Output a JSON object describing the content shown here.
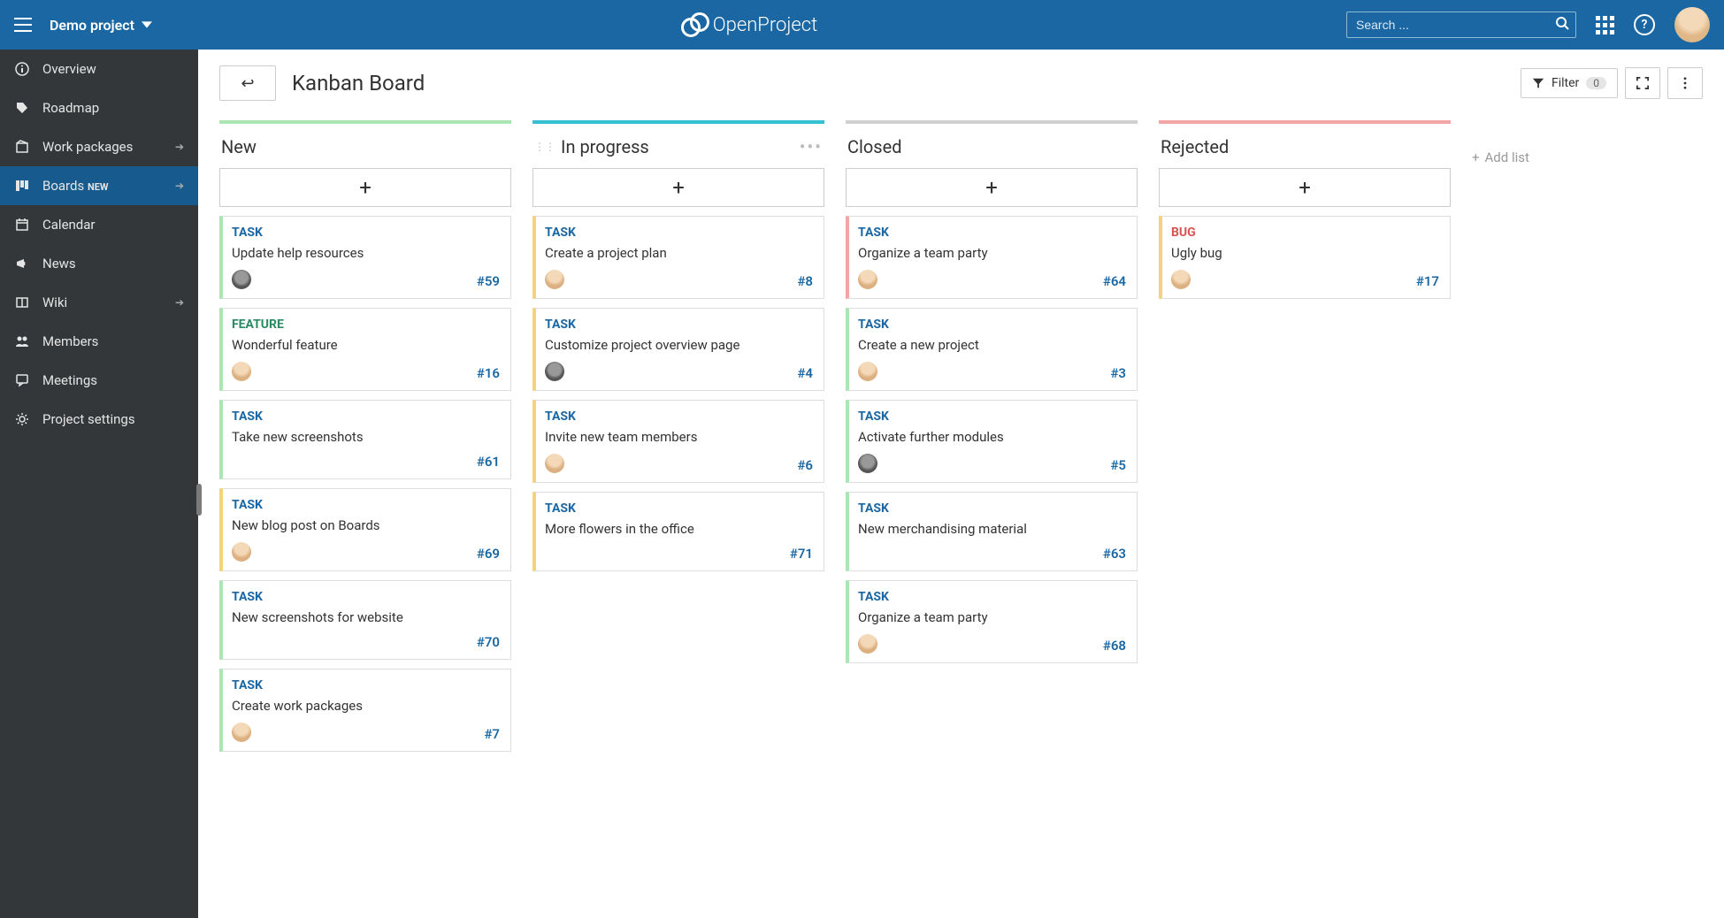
{
  "header": {
    "project_name": "Demo project",
    "app_name": "OpenProject",
    "search_placeholder": "Search ...",
    "help_char": "?"
  },
  "sidebar": {
    "items": [
      {
        "icon": "info-icon",
        "label": "Overview",
        "active": false,
        "arrow": false,
        "badge": ""
      },
      {
        "icon": "tag-icon",
        "label": "Roadmap",
        "active": false,
        "arrow": false,
        "badge": ""
      },
      {
        "icon": "package-icon",
        "label": "Work packages",
        "active": false,
        "arrow": true,
        "badge": ""
      },
      {
        "icon": "board-icon",
        "label": "Boards",
        "active": true,
        "arrow": true,
        "badge": "NEW"
      },
      {
        "icon": "calendar-icon",
        "label": "Calendar",
        "active": false,
        "arrow": false,
        "badge": ""
      },
      {
        "icon": "megaphone-icon",
        "label": "News",
        "active": false,
        "arrow": false,
        "badge": ""
      },
      {
        "icon": "book-icon",
        "label": "Wiki",
        "active": false,
        "arrow": true,
        "badge": ""
      },
      {
        "icon": "people-icon",
        "label": "Members",
        "active": false,
        "arrow": false,
        "badge": ""
      },
      {
        "icon": "chat-icon",
        "label": "Meetings",
        "active": false,
        "arrow": false,
        "badge": ""
      },
      {
        "icon": "gear-icon",
        "label": "Project settings",
        "active": false,
        "arrow": false,
        "badge": ""
      }
    ]
  },
  "board": {
    "title": "Kanban Board",
    "filter_label": "Filter",
    "filter_count": "0",
    "add_list_label": "Add list",
    "columns": [
      {
        "name": "New",
        "barColor": "#a9e6b4",
        "borderColor": "#a9e6b4",
        "showMore": false,
        "cards": [
          {
            "type": "TASK",
            "title": "Update help resources",
            "id": "#59",
            "avatar": "alt"
          },
          {
            "type": "FEATURE",
            "title": "Wonderful feature",
            "id": "#16",
            "avatar": "std"
          },
          {
            "type": "TASK",
            "title": "Take new screenshots",
            "id": "#61",
            "avatar": "none"
          },
          {
            "type": "TASK",
            "title": "New blog post on Boards",
            "id": "#69",
            "avatar": "std",
            "borderOverride": "#f4d37a"
          },
          {
            "type": "TASK",
            "title": "New screenshots for website",
            "id": "#70",
            "avatar": "none"
          },
          {
            "type": "TASK",
            "title": "Create work packages",
            "id": "#7",
            "avatar": "std"
          }
        ]
      },
      {
        "name": "In progress",
        "barColor": "#34c2d2",
        "borderColor": "#f4d37a",
        "showMore": true,
        "cards": [
          {
            "type": "TASK",
            "title": "Create a project plan",
            "id": "#8",
            "avatar": "std"
          },
          {
            "type": "TASK",
            "title": "Customize project overview page",
            "id": "#4",
            "avatar": "alt"
          },
          {
            "type": "TASK",
            "title": "Invite new team members",
            "id": "#6",
            "avatar": "std"
          },
          {
            "type": "TASK",
            "title": "More flowers in the office",
            "id": "#71",
            "avatar": "none"
          }
        ]
      },
      {
        "name": "Closed",
        "barColor": "#d0d0d0",
        "borderColor": "#a9e6b4",
        "showMore": false,
        "cards": [
          {
            "type": "TASK",
            "title": "Organize a team party",
            "id": "#64",
            "avatar": "std",
            "borderOverride": "#f3a6a6"
          },
          {
            "type": "TASK",
            "title": "Create a new project",
            "id": "#3",
            "avatar": "std"
          },
          {
            "type": "TASK",
            "title": "Activate further modules",
            "id": "#5",
            "avatar": "alt"
          },
          {
            "type": "TASK",
            "title": "New merchandising material",
            "id": "#63",
            "avatar": "none"
          },
          {
            "type": "TASK",
            "title": "Organize a team party",
            "id": "#68",
            "avatar": "std"
          }
        ]
      },
      {
        "name": "Rejected",
        "barColor": "#f3a6a6",
        "borderColor": "#f4d37a",
        "showMore": false,
        "cards": [
          {
            "type": "BUG",
            "title": "Ugly bug",
            "id": "#17",
            "avatar": "std"
          }
        ]
      }
    ]
  }
}
